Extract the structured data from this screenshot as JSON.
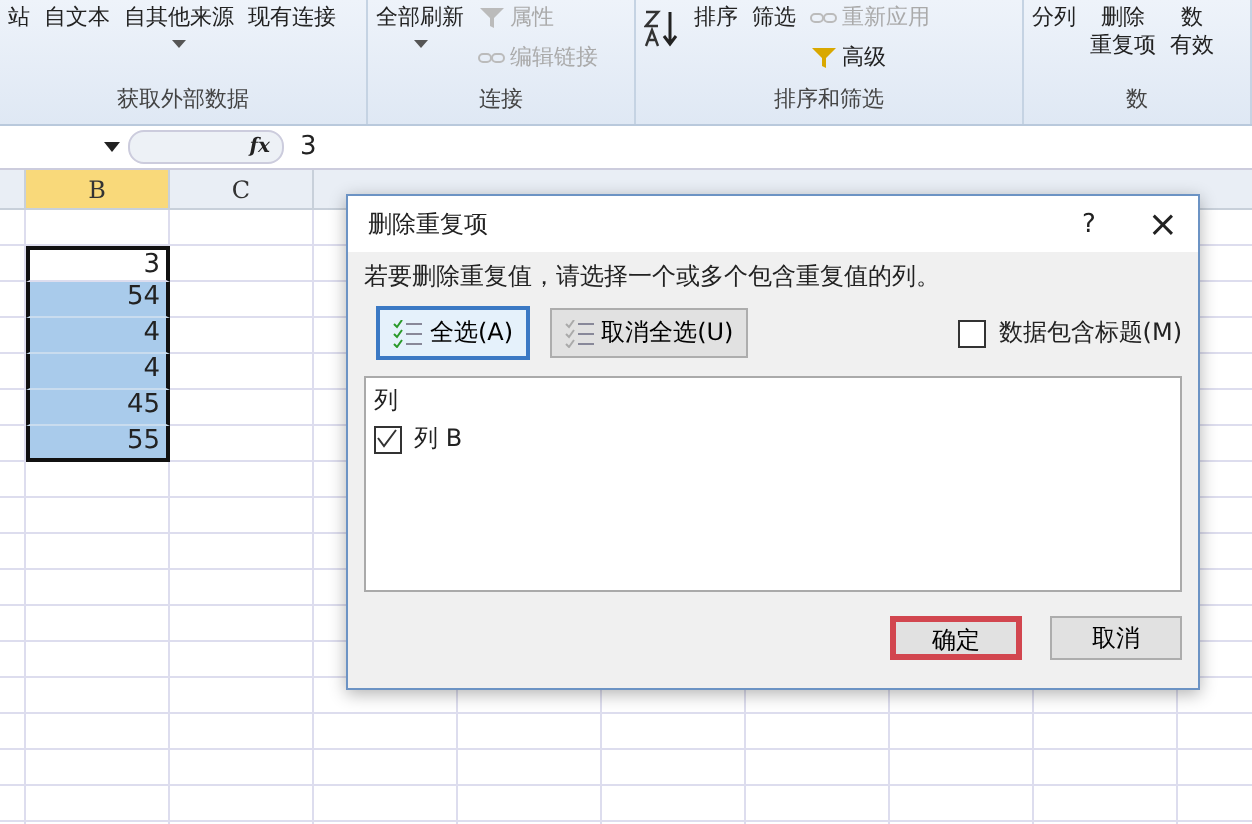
{
  "ribbon": {
    "groups": [
      {
        "label": "获取外部数据",
        "items": [
          {
            "label": "站",
            "kind": "large"
          },
          {
            "label": "自文本",
            "kind": "large"
          },
          {
            "label": "自其他来源",
            "kind": "large",
            "caret": true
          },
          {
            "label": "现有连接",
            "kind": "large"
          }
        ]
      },
      {
        "label": "连接",
        "items": [
          {
            "label": "全部刷新",
            "kind": "large",
            "caret": true
          },
          {
            "label": "属性",
            "kind": "small",
            "disabled": true
          },
          {
            "label": "编辑链接",
            "kind": "small",
            "disabled": true
          }
        ]
      },
      {
        "label": "排序和筛选",
        "items": [
          {
            "label": "排序",
            "kind": "sort"
          },
          {
            "label": "筛选",
            "kind": "large"
          },
          {
            "label": "重新应用",
            "kind": "small",
            "disabled": true
          },
          {
            "label": "高级",
            "kind": "small",
            "disabled": false
          }
        ]
      },
      {
        "label": "数",
        "items": [
          {
            "label": "分列",
            "kind": "large"
          },
          {
            "label": "删除重复项",
            "kind": "large",
            "wrap": true
          },
          {
            "label": "数有效",
            "kind": "large",
            "wrap": true
          }
        ]
      }
    ]
  },
  "formula_bar": {
    "fx_label": "fx",
    "value": "3"
  },
  "sheet": {
    "columns": [
      {
        "label": "B",
        "selected": true
      },
      {
        "label": "C",
        "selected": false
      }
    ],
    "rows": [
      {
        "value": "3",
        "selected": false
      },
      {
        "value": "54",
        "selected": true
      },
      {
        "value": "4",
        "selected": true
      },
      {
        "value": "4",
        "selected": true
      },
      {
        "value": "45",
        "selected": true
      },
      {
        "value": "55",
        "selected": true
      }
    ]
  },
  "dialog": {
    "title": "删除重复项",
    "help": "?",
    "close": "×",
    "instruction": "若要删除重复值，请选择一个或多个包含重复值的列。",
    "buttons": [
      {
        "label": "全选(A)",
        "selected": true
      },
      {
        "label": "取消全选(U)",
        "selected": false
      }
    ],
    "header_option": {
      "label": "数据包含标题(M)",
      "checked": false
    },
    "list_header": "列",
    "columns": [
      {
        "label": "列 B",
        "checked": true
      }
    ],
    "footer_buttons": [
      {
        "label": "确定",
        "highlighted": true
      },
      {
        "label": "取消",
        "highlighted": false
      }
    ]
  }
}
